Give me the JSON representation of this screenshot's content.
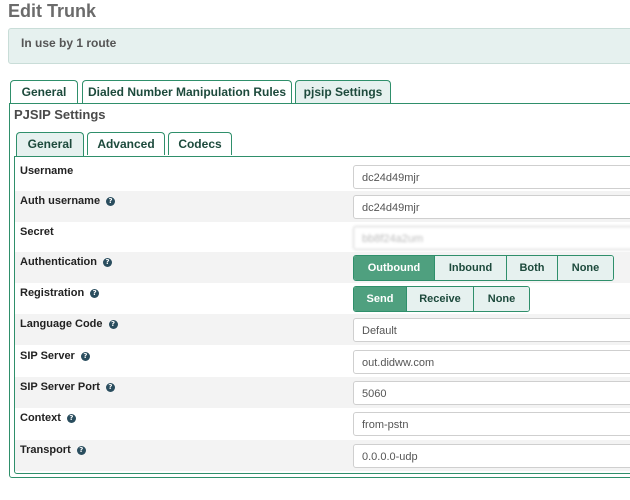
{
  "page": {
    "title": "Edit Trunk",
    "info": "In use by 1 route"
  },
  "outer_tabs": [
    {
      "label": "General",
      "active": false
    },
    {
      "label": "Dialed Number Manipulation Rules",
      "active": false
    },
    {
      "label": "pjsip Settings",
      "active": true
    }
  ],
  "section_title": "PJSIP Settings",
  "inner_tabs": [
    {
      "label": "General",
      "active": true
    },
    {
      "label": "Advanced",
      "active": false
    },
    {
      "label": "Codecs",
      "active": false
    }
  ],
  "fields": {
    "username": {
      "label": "Username",
      "value": "dc24d49mjr"
    },
    "auth_username": {
      "label": "Auth username",
      "value": "dc24d49mjr"
    },
    "secret": {
      "label": "Secret",
      "value": "bb8f24a2um"
    },
    "authentication": {
      "label": "Authentication",
      "options": [
        "Outbound",
        "Inbound",
        "Both",
        "None"
      ],
      "selected": "Outbound"
    },
    "registration": {
      "label": "Registration",
      "options": [
        "Send",
        "Receive",
        "None"
      ],
      "selected": "Send"
    },
    "language_code": {
      "label": "Language Code",
      "value": "Default"
    },
    "sip_server": {
      "label": "SIP Server",
      "value": "out.didww.com"
    },
    "sip_server_port": {
      "label": "SIP Server Port",
      "value": "5060"
    },
    "context": {
      "label": "Context",
      "value": "from-pstn"
    },
    "transport": {
      "label": "Transport",
      "value": "0.0.0.0-udp"
    }
  },
  "colors": {
    "accent": "#2f8f6b",
    "active_segment": "#4fa07f",
    "info_bg": "#e6f1ef"
  }
}
